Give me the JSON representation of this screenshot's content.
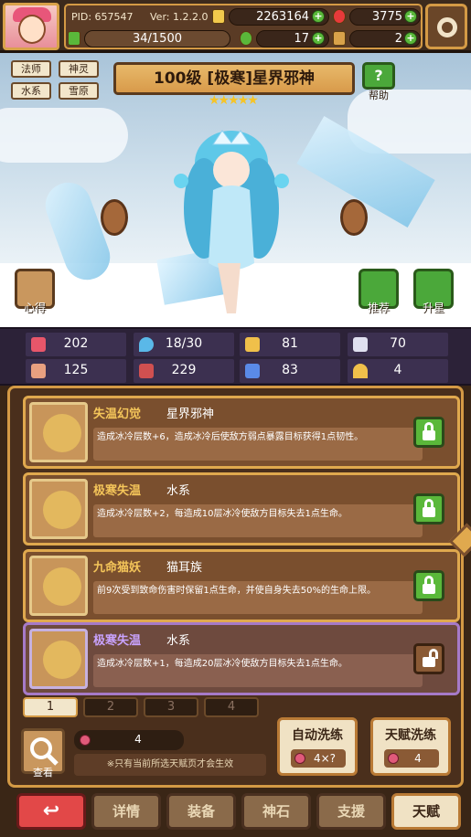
{
  "header": {
    "pid": "PID: 657547",
    "version": "Ver: 1.2.2.0",
    "gold": "2263164",
    "gems": "3775",
    "energy": "34/1500",
    "clover": "17",
    "key": "2"
  },
  "hero": {
    "tags": [
      "法师",
      "神灵",
      "水系",
      "雪原"
    ],
    "title": "100级 [极寒]星界邪神",
    "stars": "★★★★★",
    "help_label": "帮助",
    "insight_label": "心得",
    "recommend_label": "推荐",
    "upgrade_label": "升星"
  },
  "stats": [
    {
      "icon": "heart-icon",
      "value": "202",
      "color": "#e8566a"
    },
    {
      "icon": "water-drop-icon",
      "value": "18/30",
      "color": "#5ab8e8"
    },
    {
      "icon": "shield-icon",
      "value": "81",
      "color": "#f0c04a"
    },
    {
      "icon": "wing-icon",
      "value": "70",
      "color": "#e0e0f0"
    },
    {
      "icon": "fist-icon",
      "value": "125",
      "color": "#e8a080"
    },
    {
      "icon": "book-icon",
      "value": "229",
      "color": "#d05050"
    },
    {
      "icon": "stairs-icon",
      "value": "83",
      "color": "#5a8ae8"
    },
    {
      "icon": "horseshoe-icon",
      "value": "4",
      "color": "#f0c04a"
    }
  ],
  "talents": [
    {
      "name": "失温幻觉",
      "sub": "星界邪神",
      "desc": "造成冰冷层数+6，造成冰冷后使敌方弱点暴露目标获得1点韧性。",
      "locked": true
    },
    {
      "name": "极寒失温",
      "sub": "水系",
      "desc": "造成冰冷层数+2，每造成10层冰冷使敌方目标失去1点生命。",
      "locked": true
    },
    {
      "name": "九命猫妖",
      "sub": "猫耳族",
      "desc": "前9次受到致命伤害时保留1点生命，并使自身失去50%的生命上限。",
      "locked": true
    },
    {
      "name": "极寒失温",
      "sub": "水系",
      "desc": "造成冰冷层数+1，每造成20层冰冷使敌方目标失去1点生命。",
      "locked": false
    }
  ],
  "pages": [
    "1",
    "2",
    "3",
    "4"
  ],
  "controls": {
    "view_label": "查看",
    "resource_count": "4",
    "note": "※只有当前所选天赋页才会生效",
    "auto_wash_label": "自动洗练",
    "auto_wash_cost": "4×?",
    "talent_wash_label": "天赋洗练",
    "talent_wash_cost": "4"
  },
  "nav": {
    "back": "↩",
    "items": [
      "详情",
      "装备",
      "神石",
      "支援",
      "天赋"
    ]
  }
}
